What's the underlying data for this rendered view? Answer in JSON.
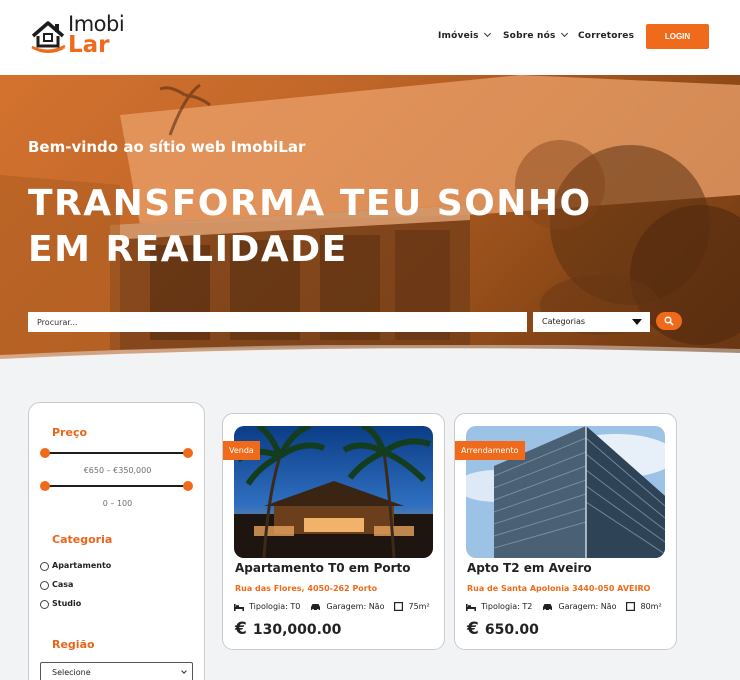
{
  "brand": {
    "line1": "Imobi",
    "line2": "Lar"
  },
  "nav": {
    "items": [
      {
        "label": "Imóveis",
        "has_dropdown": true
      },
      {
        "label": "Sobre nós",
        "has_dropdown": true
      },
      {
        "label": "Corretores",
        "has_dropdown": false
      }
    ],
    "login_label": "LOGIN"
  },
  "hero": {
    "welcome": "Bem-vindo ao sítio web ImobiLar",
    "title": "TRANSFORMA TEU SONHO EM REALIDADE",
    "search_placeholder": "Procurar...",
    "category_select": "Categorias"
  },
  "filters": {
    "price_title": "Preço",
    "price_range": "€650 – €350,000",
    "second_range": "0 – 100",
    "category_title": "Categoria",
    "categories": [
      "Apartamento",
      "Casa",
      "Studio"
    ],
    "region_title": "Região",
    "region_select": "Selecione"
  },
  "listings": [
    {
      "tag": "Venda",
      "title": "Apartamento T0 em Porto",
      "address": "Rua das Flores, 4050-262 Porto",
      "tipologia": "Tipologia: T0",
      "garagem": "Garagem: Não",
      "area": "75m²",
      "currency": "€",
      "price": "130,000.00"
    },
    {
      "tag": "Arrendamento",
      "title": "Apto T2 em Aveiro",
      "address": "Rua de Santa Apolonia 3440-050 AVEIRO",
      "tipologia": "Tipologia: T2",
      "garagem": "Garagem: Não",
      "area": "80m²",
      "currency": "€",
      "price": "650.00"
    }
  ],
  "colors": {
    "accent": "#ef6a1a",
    "text": "#222222",
    "background": "#f2f3f5"
  }
}
